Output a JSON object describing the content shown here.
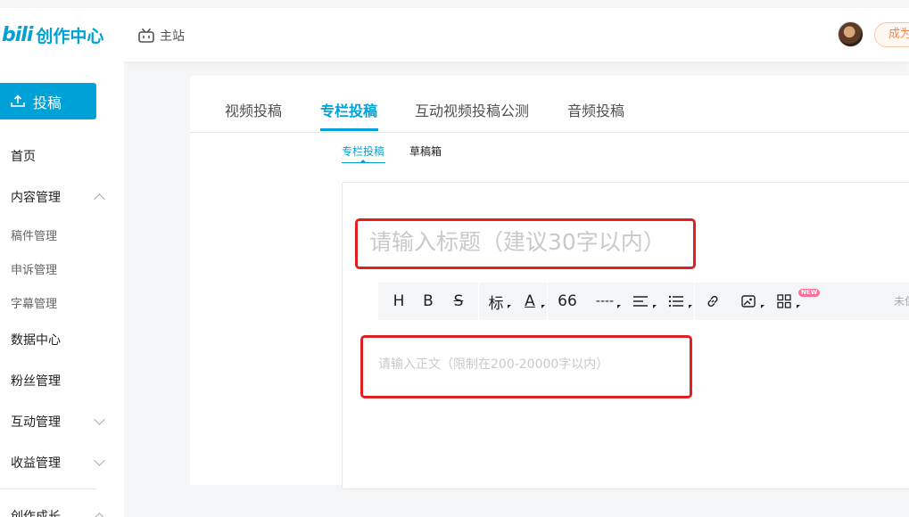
{
  "header": {
    "logo_mark": "bili",
    "logo_text": "创作中心",
    "home_label": "主站",
    "vip_label": "成为"
  },
  "sidebar": {
    "upload_label": "投稿",
    "items": [
      {
        "label": "首页"
      },
      {
        "label": "内容管理",
        "expanded": true
      },
      {
        "label": "稿件管理"
      },
      {
        "label": "申诉管理"
      },
      {
        "label": "字幕管理"
      },
      {
        "label": "数据中心"
      },
      {
        "label": "粉丝管理"
      },
      {
        "label": "互动管理",
        "expanded": false
      },
      {
        "label": "收益管理",
        "expanded": false
      },
      {
        "label": "创作成长",
        "expanded": true
      }
    ]
  },
  "main": {
    "tabs": [
      {
        "label": "视频投稿"
      },
      {
        "label": "专栏投稿",
        "active": true
      },
      {
        "label": "互动视频投稿公测"
      },
      {
        "label": "音频投稿"
      }
    ],
    "subtabs": [
      {
        "label": "专栏投稿",
        "active": true
      },
      {
        "label": "草稿箱"
      }
    ],
    "editor": {
      "title_placeholder": "请输入标题（建议30字以内）",
      "body_placeholder": "请输入正文（限制在200-20000字以内）",
      "toolbar": {
        "heading": "H",
        "bold": "B",
        "strike": "S",
        "title_style": "标",
        "font_color": "A",
        "quote": "66",
        "divider": "----",
        "new_badge": "NEW",
        "right_text": "未保"
      }
    }
  },
  "colors": {
    "accent": "#00a1d6",
    "highlight_box": "#e02020",
    "new_badge": "#fb7299"
  }
}
